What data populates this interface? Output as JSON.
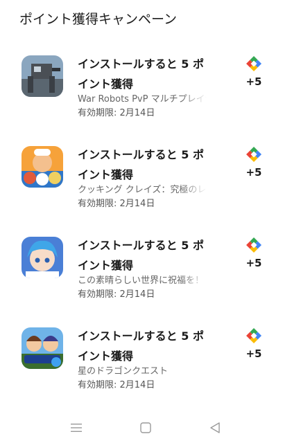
{
  "header": {
    "title": "ポイント獲得キャンペーン"
  },
  "offers": [
    {
      "title": "インストールすると 5 ポイント獲得",
      "app_name": "War Robots PvP マルチプレイヤー",
      "expiry": "有効期限: 2月14日",
      "points": "+5",
      "icon": "war-robots-app-icon"
    },
    {
      "title": "インストールすると 5 ポイント獲得",
      "app_name": "クッキング クレイズ：究極のレストランゲーム",
      "expiry": "有効期限: 2月14日",
      "points": "+5",
      "icon": "cooking-craze-app-icon"
    },
    {
      "title": "インストールすると 5 ポイント獲得",
      "app_name": "この素晴らしい世界に祝福を！",
      "expiry": "有効期限: 2月14日",
      "points": "+5",
      "icon": "konosuba-app-icon"
    },
    {
      "title": "インストールすると 5 ポイント獲得",
      "app_name": "星のドラゴンクエスト",
      "expiry": "有効期限: 2月14日",
      "points": "+5",
      "icon": "dragon-quest-app-icon"
    }
  ],
  "reward_icon": "play-points-diamond-icon",
  "nav": {
    "menu_icon": "menu-icon",
    "home_icon": "home-square-icon",
    "back_icon": "back-triangle-icon"
  },
  "colors": {
    "text_primary": "#1a1a1a",
    "text_secondary": "#666666",
    "play_green": "#34a853",
    "play_red": "#ea4335",
    "play_yellow": "#fbbc04",
    "play_blue": "#4285f4"
  }
}
